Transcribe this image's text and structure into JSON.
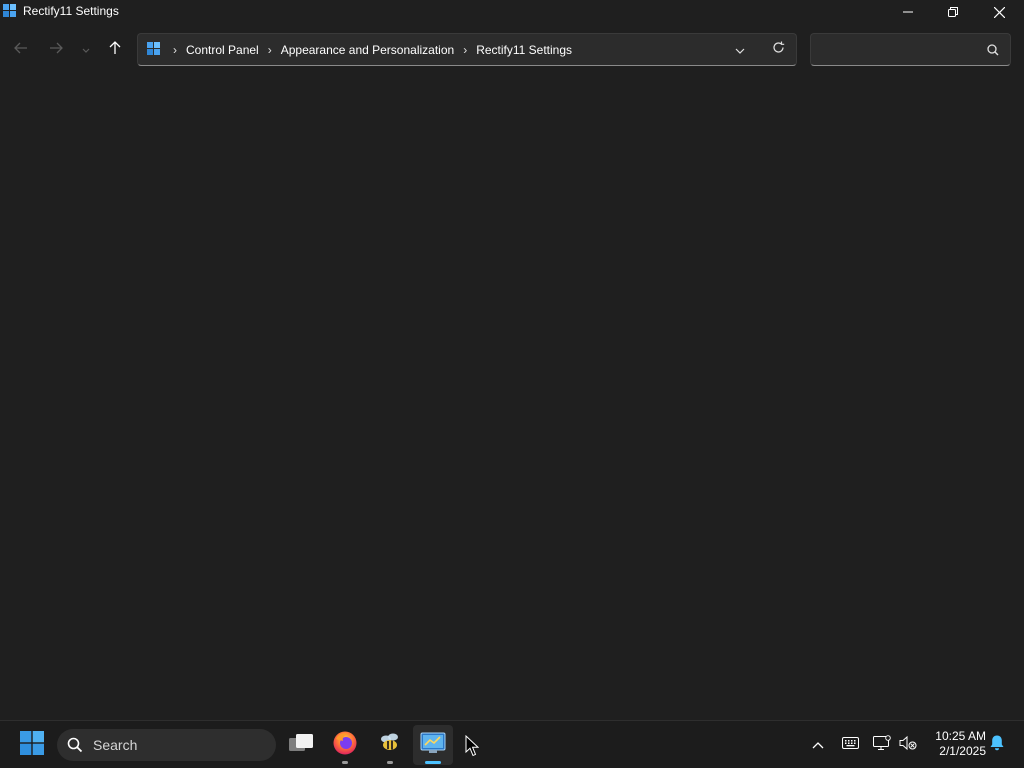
{
  "window": {
    "title": "Rectify11 Settings",
    "controls": {
      "minimize_icon": "minimize-icon",
      "maximize_icon": "restore-icon",
      "close_icon": "close-icon"
    }
  },
  "navigation": {
    "back_icon": "arrow-left-icon",
    "forward_icon": "arrow-right-icon",
    "recent_icon": "chevron-down-icon",
    "up_icon": "arrow-up-icon"
  },
  "address_bar": {
    "root_icon": "control-panel-icon",
    "breadcrumbs": [
      "Control Panel",
      "Appearance and Personalization",
      "Rectify11 Settings"
    ],
    "separator": "›",
    "dropdown_icon": "chevron-down-icon",
    "refresh_icon": "refresh-icon"
  },
  "search": {
    "value": "",
    "placeholder": "",
    "icon": "search-icon"
  },
  "taskbar": {
    "start_icon": "windows-logo-icon",
    "search_label": "Search",
    "apps": [
      {
        "name": "Task View",
        "icon": "task-view-icon",
        "active": false
      },
      {
        "name": "Firefox",
        "icon": "firefox-icon",
        "active": false,
        "running": true
      },
      {
        "name": "Bee app",
        "icon": "bee-icon",
        "active": false,
        "running": true
      },
      {
        "name": "Control Panel",
        "icon": "control-panel-icon",
        "active": true
      }
    ],
    "tray": {
      "chevron_icon": "chevron-up-icon",
      "keyboard_icon": "keyboard-icon",
      "network_icon": "network-icon",
      "volume_icon": "volume-muted-icon",
      "time": "10:25 AM",
      "date": "2/1/2025",
      "notification_icon": "bell-icon"
    }
  },
  "colors": {
    "window_bg": "#1f1f1f",
    "taskbar_bg": "#1c1c1c",
    "accent": "#4cc2ff",
    "firefox_orange": "#ff7139",
    "windows_blue": "#3a9be6"
  }
}
